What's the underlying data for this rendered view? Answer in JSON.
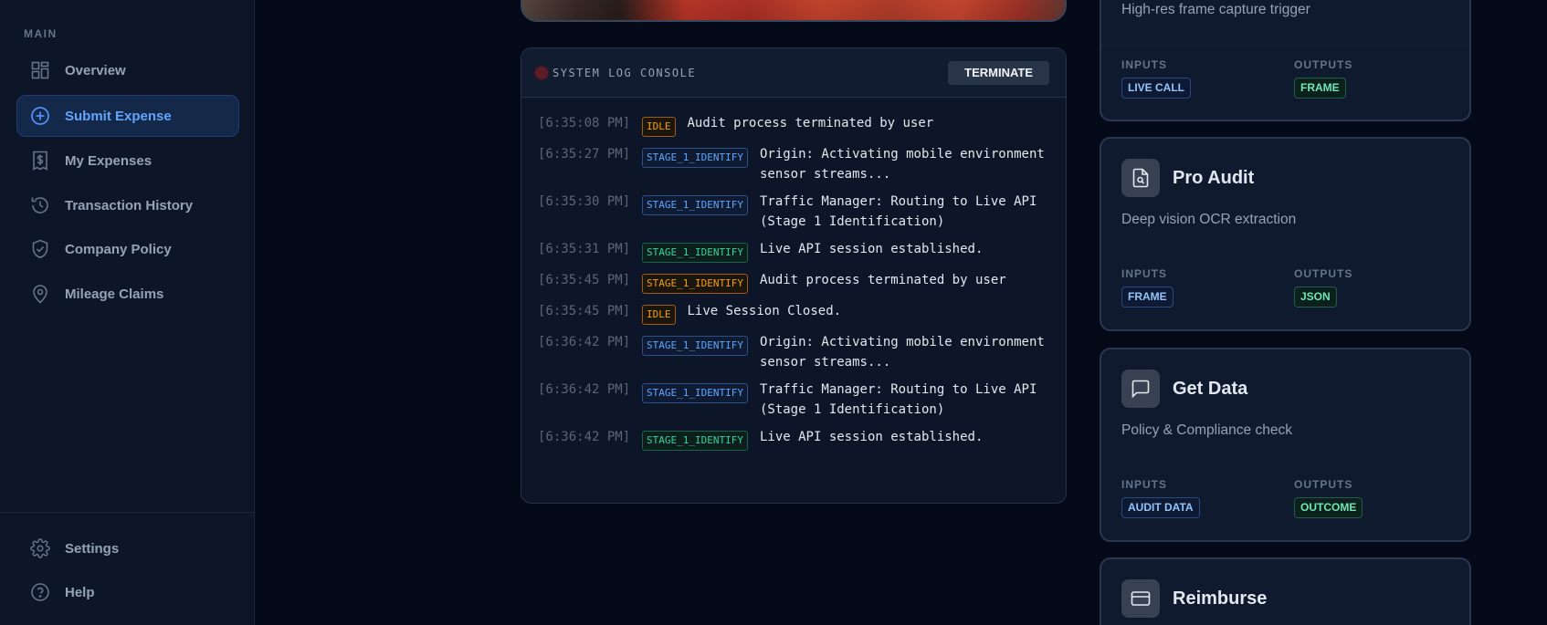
{
  "sidebar": {
    "section_label": "MAIN",
    "items": [
      {
        "label": "Overview",
        "icon": "grid-icon"
      },
      {
        "label": "Submit Expense",
        "icon": "plus-circle-icon",
        "active": true
      },
      {
        "label": "My Expenses",
        "icon": "receipt-dollar-icon"
      },
      {
        "label": "Transaction History",
        "icon": "history-icon"
      },
      {
        "label": "Company Policy",
        "icon": "shield-check-icon"
      },
      {
        "label": "Mileage Claims",
        "icon": "map-pin-icon"
      }
    ],
    "bottom_items": [
      {
        "label": "Settings",
        "icon": "gear-icon"
      },
      {
        "label": "Help",
        "icon": "help-circle-icon"
      }
    ]
  },
  "console": {
    "title": "SYSTEM LOG CONSOLE",
    "terminate_label": "TERMINATE",
    "logs": [
      {
        "ts": "[6:35:08 PM]",
        "tag": "IDLE",
        "color": "orange",
        "msg": "Audit process terminated by user"
      },
      {
        "ts": "[6:35:27 PM]",
        "tag": "STAGE_1_IDENTIFY",
        "color": "blue",
        "msg": "Origin: Activating mobile environment sensor streams..."
      },
      {
        "ts": "[6:35:30 PM]",
        "tag": "STAGE_1_IDENTIFY",
        "color": "blue",
        "msg": "Traffic Manager: Routing to Live API (Stage 1 Identification)"
      },
      {
        "ts": "[6:35:31 PM]",
        "tag": "STAGE_1_IDENTIFY",
        "color": "green",
        "msg": "Live API session established."
      },
      {
        "ts": "[6:35:45 PM]",
        "tag": "STAGE_1_IDENTIFY",
        "color": "orange",
        "msg": "Audit process terminated by user"
      },
      {
        "ts": "[6:35:45 PM]",
        "tag": "IDLE",
        "color": "orange",
        "msg": "Live Session Closed."
      },
      {
        "ts": "[6:36:42 PM]",
        "tag": "STAGE_1_IDENTIFY",
        "color": "blue",
        "msg": "Origin: Activating mobile environment sensor streams..."
      },
      {
        "ts": "[6:36:42 PM]",
        "tag": "STAGE_1_IDENTIFY",
        "color": "blue",
        "msg": "Traffic Manager: Routing to Live API (Stage 1 Identification)"
      },
      {
        "ts": "[6:36:42 PM]",
        "tag": "STAGE_1_IDENTIFY",
        "color": "green",
        "msg": "Live API session established."
      }
    ]
  },
  "cards": [
    {
      "title": "",
      "desc": "High-res frame capture trigger",
      "inputs_label": "INPUTS",
      "outputs_label": "OUTPUTS",
      "input": "LIVE CALL",
      "output": "FRAME"
    },
    {
      "title": "Pro Audit",
      "icon": "document-search-icon",
      "desc": "Deep vision OCR extraction",
      "inputs_label": "INPUTS",
      "outputs_label": "OUTPUTS",
      "input": "FRAME",
      "output": "JSON"
    },
    {
      "title": "Get Data",
      "icon": "message-square-icon",
      "desc": "Policy & Compliance check",
      "inputs_label": "INPUTS",
      "outputs_label": "OUTPUTS",
      "input": "AUDIT DATA",
      "output": "OUTCOME"
    },
    {
      "title": "Reimburse",
      "icon": "credit-card-icon"
    }
  ]
}
